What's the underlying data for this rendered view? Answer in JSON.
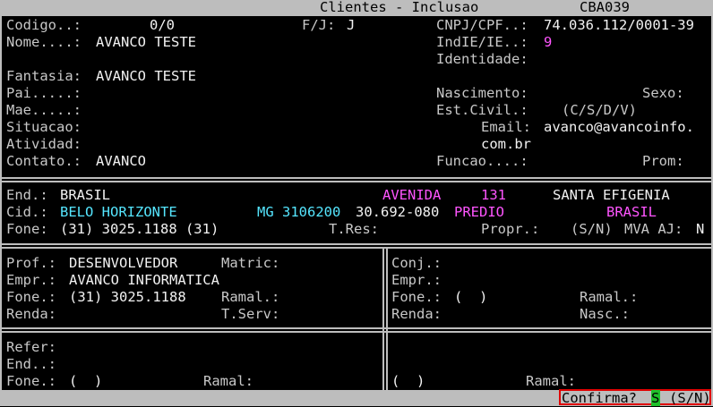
{
  "titlebar": {
    "title": "Clientes - Inclusao",
    "code": "CBA039"
  },
  "top": {
    "codigo_label": "Codigo..:",
    "codigo_value": "0/0",
    "fj_label": "F/J:",
    "fj_value": "J",
    "cnpj_label": "CNPJ/CPF..:",
    "cnpj_value": "74.036.112/0001-39",
    "nome_label": "Nome....:",
    "nome_value": "AVANCO TESTE",
    "indie_label": "IndIE/IE..:",
    "indie_value": "9",
    "identidade_label": "Identidade:",
    "fantasia_label": "Fantasia:",
    "fantasia_value": "AVANCO TESTE",
    "pai_label": "Pai.....:",
    "nascimento_label": "Nascimento:",
    "sexo_label": "Sexo:",
    "mae_label": "Mae.....:",
    "estcivil_label": "Est.Civil.:",
    "estcivil_value": "(C/S/D/V)",
    "situacao_label": "Situacao:",
    "email_label": "Email:",
    "email_value_1": "avanco@avancoinfo.",
    "email_value_2": "com.br",
    "atividade_label": "Atividad:",
    "contato_label": "Contato.:",
    "contato_value": "AVANCO",
    "funcao_label": "Funcao....:",
    "prom_label": "Prom:"
  },
  "address": {
    "end_label": "End.:",
    "end_value": "BRASIL",
    "logradouro_tipo": "AVENIDA",
    "numero": "131",
    "bairro": "SANTA EFIGENIA",
    "cid_label": "Cid.:",
    "cidade": "BELO HORIZONTE",
    "uf_codigo": "MG 3106200",
    "cep": "30.692-080",
    "complemento": "PREDIO",
    "pais": "BRASIL",
    "fone_label": "Fone:",
    "fone_value": "(31) 3025.1188 (31)",
    "tres_label": "T.Res:",
    "propr_label": "Propr.:",
    "propr_value": "(S/N)",
    "mva_label": "MVA AJ:",
    "mva_value": "N"
  },
  "work_left": {
    "prof_label": "Prof.:",
    "prof_value": "DESENVOLVEDOR",
    "matric_label": "Matric:",
    "empr_label": "Empr.:",
    "empr_value": "AVANCO INFORMATICA",
    "fone_label": "Fone.:",
    "fone_value": "(31) 3025.1188",
    "ramal_label": "Ramal.:",
    "renda_label": "Renda:",
    "tserv_label": "T.Serv:"
  },
  "work_right": {
    "conj_label": "Conj.:",
    "empr_label": "Empr.:",
    "fone_label": "Fone.:",
    "fone_value": "(  )",
    "ramal_label": "Ramal.:",
    "renda_label": "Renda:",
    "nasc_label": "Nasc.:"
  },
  "refs": {
    "refer_label": "Refer:",
    "end_label": "End..:",
    "fone_label": "Fone.:",
    "fone_value": "(  )",
    "ramal_label": "Ramal:",
    "right_fone_value": "(  )",
    "right_ramal_label": "Ramal:"
  },
  "confirm": {
    "prompt": "Confirma?",
    "value": "S",
    "options": "(S/N)"
  }
}
